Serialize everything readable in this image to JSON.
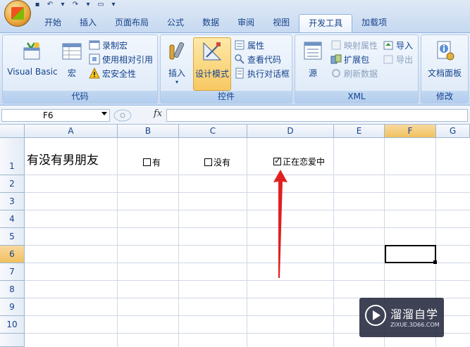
{
  "tabs": [
    "开始",
    "插入",
    "页面布局",
    "公式",
    "数据",
    "审阅",
    "视图",
    "开发工具",
    "加载项"
  ],
  "active_tab": "开发工具",
  "ribbon": {
    "code_group": {
      "label": "代码",
      "visual_basic": "Visual Basic",
      "macros": "宏",
      "record_macro": "录制宏",
      "relative_ref": "使用相对引用",
      "macro_security": "宏安全性"
    },
    "controls_group": {
      "label": "控件",
      "insert": "插入",
      "design_mode": "设计模式",
      "properties": "属性",
      "view_code": "查看代码",
      "run_dialog": "执行对话框"
    },
    "xml_group": {
      "label": "XML",
      "source": "源",
      "map_properties": "映射属性",
      "expansion_packs": "扩展包",
      "refresh_data": "刷新数据",
      "import": "导入",
      "export": "导出"
    },
    "modify_group": {
      "label": "修改",
      "document_panel": "文档面板"
    }
  },
  "formula_bar": {
    "name_box": "F6",
    "fx": "fx",
    "formula": ""
  },
  "sheet": {
    "columns": [
      "A",
      "B",
      "C",
      "D",
      "E",
      "F",
      "G"
    ],
    "rows": [
      "1",
      "2",
      "3",
      "4",
      "5",
      "6",
      "7",
      "8",
      "9",
      "10"
    ],
    "selected_column": "F",
    "selected_row": "6",
    "a1_text": "有没有男朋友",
    "checkboxes": [
      {
        "label": "有",
        "checked": false
      },
      {
        "label": "没有",
        "checked": false
      },
      {
        "label": "正在恋爱中",
        "checked": true
      }
    ]
  },
  "annotation": {
    "arrow_color": "#e02020"
  },
  "watermark": {
    "title": "溜溜自学",
    "url": "ZIXUE.3D66.COM"
  }
}
